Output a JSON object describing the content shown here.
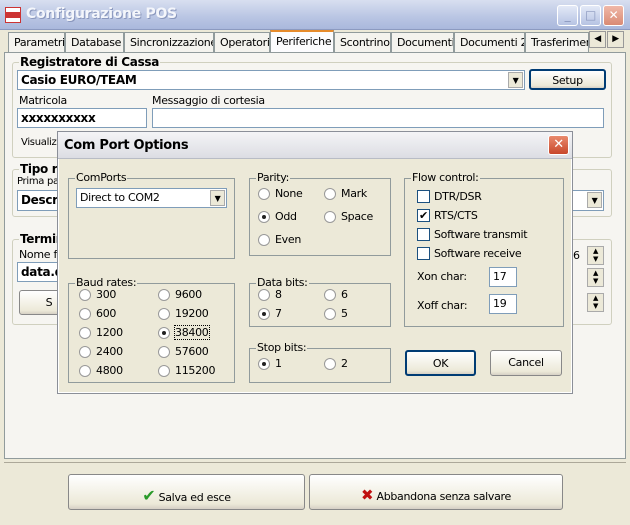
{
  "window": {
    "title": "Configurazione POS",
    "min": "_",
    "max": "□",
    "close": "✕"
  },
  "tabs": [
    "Parametri",
    "Database",
    "Sincronizzazione",
    "Operatori",
    "Periferiche",
    "Scontrino",
    "Documenti",
    "Documenti 2",
    "Trasferiment"
  ],
  "active_tab": "Periferiche",
  "registratore": {
    "label": "Registratore di Cassa",
    "device": "Casio EURO/TEAM",
    "setup": "Setup",
    "matricola_label": "Matricola",
    "matricola": "xxxxxxxxxx",
    "messaggio_label": "Messaggio di cortesia",
    "messaggio": "",
    "visualiz": "Visualiz"
  },
  "tipo": {
    "label": "Tipo ri",
    "prima": "Prima pa",
    "descr": "Descriz"
  },
  "terminal": {
    "label": "Termin",
    "nome": "Nome fi",
    "file": "data.d",
    "btn": "S",
    "spin_value": "6"
  },
  "footer": {
    "save": "Salva ed esce",
    "cancel": "Abbandona senza salvare"
  },
  "dialog": {
    "title": "Com Port Options",
    "comports": {
      "label": "ComPorts",
      "value": "Direct to COM2"
    },
    "baud": {
      "label": "Baud rates:",
      "options": [
        "300",
        "600",
        "1200",
        "2400",
        "4800",
        "9600",
        "19200",
        "38400",
        "57600",
        "115200"
      ],
      "selected": "38400"
    },
    "parity": {
      "label": "Parity:",
      "options": [
        "None",
        "Odd",
        "Even",
        "Mark",
        "Space"
      ],
      "selected": "Odd"
    },
    "databits": {
      "label": "Data bits:",
      "options": [
        "8",
        "7",
        "6",
        "5"
      ],
      "selected": "7"
    },
    "stopbits": {
      "label": "Stop bits:",
      "options": [
        "1",
        "2"
      ],
      "selected": "1"
    },
    "flow": {
      "label": "Flow control:",
      "options": [
        {
          "label": "DTR/DSR",
          "checked": false
        },
        {
          "label": "RTS/CTS",
          "checked": true
        },
        {
          "label": "Software transmit",
          "checked": false
        },
        {
          "label": "Software receive",
          "checked": false
        }
      ],
      "xon_label": "Xon char:",
      "xon": "17",
      "xoff_label": "Xoff char:",
      "xoff": "19"
    },
    "ok": "OK",
    "cancel": "Cancel"
  }
}
